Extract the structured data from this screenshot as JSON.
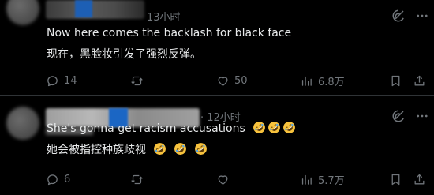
{
  "tweets": [
    {
      "timestamp": "13小时",
      "line1": "Now here comes the backlash for black face",
      "line2": "现在，黑脸妆引发了强烈反弹。",
      "replies": "14",
      "retweets": "",
      "likes": "50",
      "views": "6.8万"
    },
    {
      "timestamp": "· 12小时",
      "line1": "She's gonna get racism accusations",
      "line2": "她会被指控种族歧视",
      "replies": "6",
      "retweets": "",
      "likes": "",
      "views": "5.7万"
    }
  ],
  "icons": {
    "grok": "grok-icon",
    "more": "more-icon",
    "reply": "reply-icon",
    "retweet": "retweet-icon",
    "like": "heart-icon",
    "views": "views-chart-icon",
    "bookmark": "bookmark-icon",
    "share": "share-icon",
    "emoji": "rolling-on-floor-laughing-emoji"
  },
  "colors": {
    "background": "#000000",
    "text": "#e7e9ea",
    "muted": "#71767b",
    "divider": "#2f3336",
    "emoji": "#f7c23d"
  }
}
